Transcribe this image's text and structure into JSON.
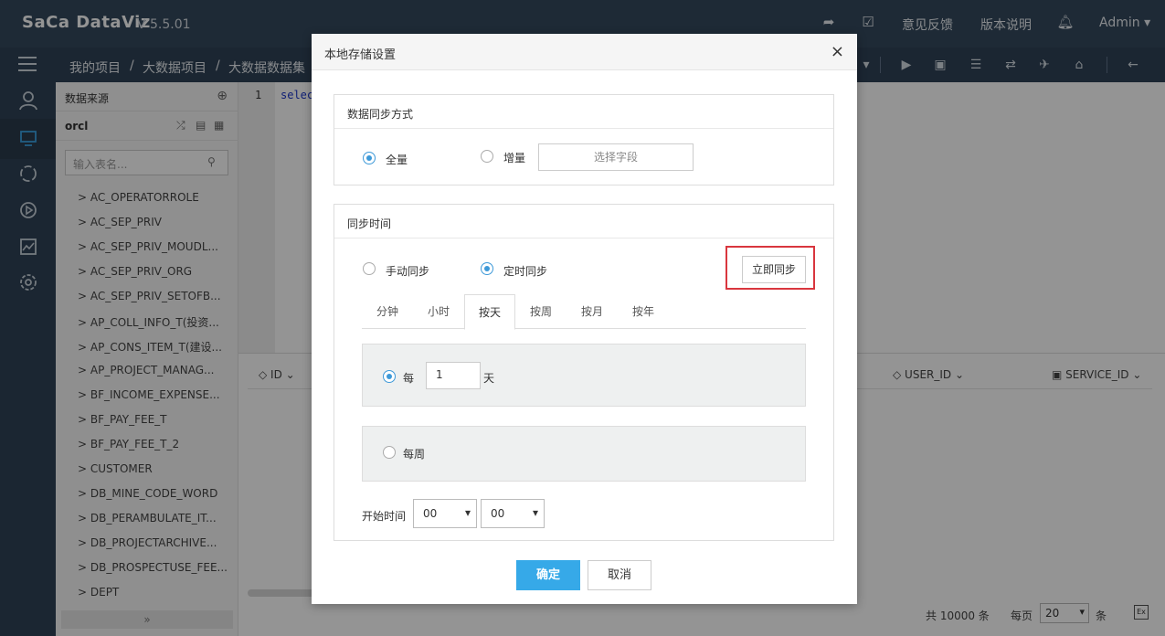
{
  "app": {
    "logo": "SaCa DataViz",
    "version": "V 5.5.01",
    "links": {
      "feedback": "意见反馈",
      "release_notes": "版本说明",
      "user": "Admin ▾"
    }
  },
  "breadcrumb": {
    "items": [
      "我的项目",
      "/",
      "大数据项目",
      "/",
      "大数据数据集"
    ]
  },
  "sidebar": {
    "title": "数据来源",
    "db": "orcl",
    "search_placeholder": "输入表名...",
    "tables": [
      "> AC_OPERATORROLE",
      "> AC_SEP_PRIV",
      "> AC_SEP_PRIV_MOUDL...",
      "> AC_SEP_PRIV_ORG",
      "> AC_SEP_PRIV_SETOFB...",
      "> AP_COLL_INFO_T(投资...",
      "> AP_CONS_ITEM_T(建设...",
      "> AP_PROJECT_MANAG...",
      "> BF_INCOME_EXPENSE...",
      "> BF_PAY_FEE_T",
      "> BF_PAY_FEE_T_2",
      "> CUSTOMER",
      "> DB_MINE_CODE_WORD",
      "> DB_PERAMBULATE_IT...",
      "> DB_PROJECTARCHIVE...",
      "> DB_PROSPECTUSE_FEE...",
      "> DEPT"
    ],
    "footer": "»"
  },
  "editor": {
    "line": "1",
    "code": "selec"
  },
  "results": {
    "columns": [
      "ID ⌄",
      "USER_ID ⌄",
      "SERVICE_ID ⌄"
    ],
    "total": "共 10000 条",
    "per_page_label": "每页",
    "per_page_value": "20",
    "unit": "条"
  },
  "dialog": {
    "title": "本地存储设置",
    "close": "×",
    "sync_mode": {
      "title": "数据同步方式",
      "full": "全量",
      "incremental": "增量",
      "select_field": "选择字段"
    },
    "sync_time": {
      "title": "同步时间",
      "manual": "手动同步",
      "scheduled": "定时同步",
      "sync_now": "立即同步",
      "tabs": [
        "分钟",
        "小时",
        "按天",
        "按周",
        "按月",
        "按年"
      ],
      "active_tab": "按天",
      "every": "每",
      "every_value": "1",
      "day_unit": "天",
      "weekly": "每周",
      "start_time_label": "开始时间",
      "hour": "00",
      "minute": "00"
    },
    "ok": "确定",
    "cancel": "取消"
  },
  "colors": {
    "accent": "#36a9e8",
    "radio": "#3d99d8",
    "highlight": "#d9363e",
    "header": "#34495e"
  }
}
